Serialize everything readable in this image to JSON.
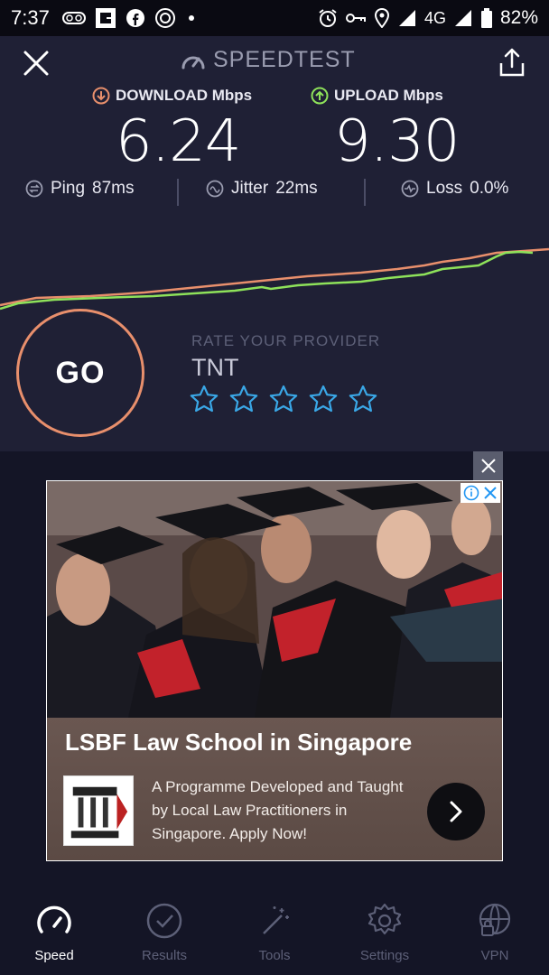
{
  "status_bar": {
    "time": "7:37",
    "network": "4G",
    "battery": "82%"
  },
  "header": {
    "title": "SPEEDTEST"
  },
  "metrics": {
    "download_label": "DOWNLOAD Mbps",
    "download_value": "6.24",
    "upload_label": "UPLOAD Mbps",
    "upload_value": "9.30"
  },
  "stats": {
    "ping_label": "Ping",
    "ping_value": "87ms",
    "jitter_label": "Jitter",
    "jitter_value": "22ms",
    "loss_label": "Loss",
    "loss_value": "0.0%"
  },
  "test": {
    "go_label": "GO",
    "rate_label": "RATE YOUR PROVIDER",
    "provider": "TNT",
    "stars_total": 5,
    "stars_filled": 0
  },
  "ad": {
    "headline": "LSBF Law School in Singapore",
    "body": "A Programme Developed and Taught by Local Law Practitioners in Singapore. Apply Now!"
  },
  "nav": {
    "items": [
      {
        "label": "Speed",
        "icon": "speedometer-icon"
      },
      {
        "label": "Results",
        "icon": "check-circle-icon"
      },
      {
        "label": "Tools",
        "icon": "magic-wand-icon"
      },
      {
        "label": "Settings",
        "icon": "gear-icon"
      },
      {
        "label": "VPN",
        "icon": "globe-lock-icon"
      }
    ]
  },
  "colors": {
    "accent_orange": "#e88f6c",
    "accent_green": "#8ee25a",
    "star_blue": "#3aa7e6",
    "background": "#1f2035"
  }
}
